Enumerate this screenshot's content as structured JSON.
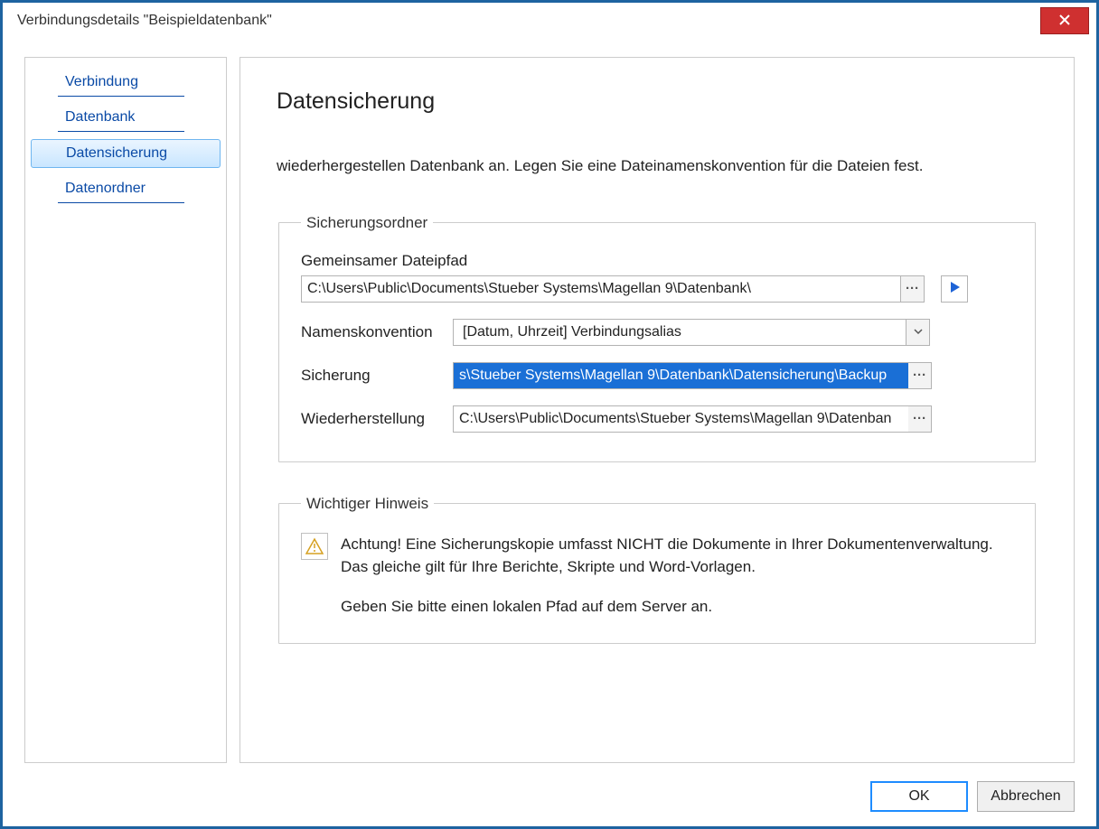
{
  "window": {
    "title": "Verbindungsdetails \"Beispieldatenbank\""
  },
  "sidebar": {
    "items": [
      {
        "label": "Verbindung",
        "selected": false
      },
      {
        "label": "Datenbank",
        "selected": false
      },
      {
        "label": "Datensicherung",
        "selected": true
      },
      {
        "label": "Datenordner",
        "selected": false
      }
    ]
  },
  "main": {
    "page_title": "Datensicherung",
    "intro_text": "wiederhergestellen Datenbank an. Legen Sie eine Dateinamenskonvention für die Dateien fest.",
    "folder_group": {
      "legend": "Sicherungsordner",
      "shared_path_label": "Gemeinsamer Dateipfad",
      "shared_path_value": "C:\\Users\\Public\\Documents\\Stueber Systems\\Magellan 9\\Datenbank\\",
      "naming_label": "Namenskonvention",
      "naming_value": "[Datum, Uhrzeit] Verbindungsalias",
      "backup_label": "Sicherung",
      "backup_value": "s\\Stueber Systems\\Magellan 9\\Datenbank\\Datensicherung\\Backup",
      "restore_label": "Wiederherstellung",
      "restore_value": "C:\\Users\\Public\\Documents\\Stueber Systems\\Magellan 9\\Datenban"
    },
    "hint_group": {
      "legend": "Wichtiger Hinweis",
      "line1": "Achtung! Eine Sicherungskopie umfasst NICHT die Dokumente in Ihrer Dokumentenverwaltung. Das gleiche gilt für Ihre Berichte, Skripte und Word-Vorlagen.",
      "line2": "Geben Sie bitte einen lokalen Pfad auf dem Server an."
    }
  },
  "footer": {
    "ok_label": "OK",
    "cancel_label": "Abbrechen"
  },
  "icons": {
    "browse": "···",
    "close": "close-icon",
    "play": "play-icon",
    "chevron_down": "chevron-down-icon",
    "warning": "warning-icon"
  }
}
